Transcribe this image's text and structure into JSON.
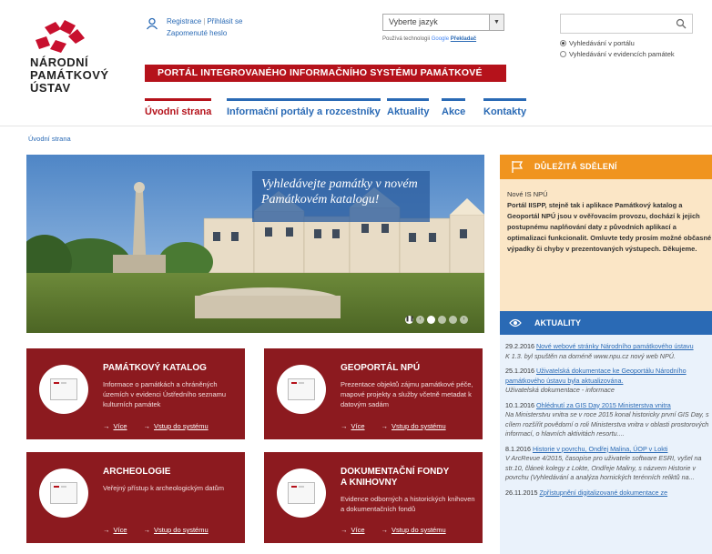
{
  "logo": {
    "text_line1": "NÁRODNÍ",
    "text_line2": "PAMÁTKOVÝ",
    "text_line3": "ÚSTAV"
  },
  "user": {
    "register": "Registrace",
    "login": "Přihlásit se",
    "forgot": "Zapomenuté heslo"
  },
  "language": {
    "selected": "Vyberte jazyk",
    "powered_prefix": "Používá technologii",
    "google": "Google",
    "translate": "Překladač"
  },
  "search": {
    "placeholder": "",
    "radio_portal": "Vyhledávání v portálu",
    "radio_evidence": "Vyhledávání v evidencích památek"
  },
  "banner": "PORTÁL INTEGROVANÉHO INFORMAČNÍHO SYSTÉMU PAMÁTKOVÉ PÉČE",
  "nav": [
    "Úvodní strana",
    "Informační portály a rozcestníky",
    "Aktuality",
    "Akce",
    "Kontakty"
  ],
  "breadcrumb": "Úvodní strana",
  "hero": {
    "caption_line1": "Vyhledávejte památky v novém",
    "caption_line2": "Památkovém katalogu!"
  },
  "cards": [
    {
      "title": "PAMÁTKOVÝ KATALOG",
      "title2": "",
      "desc": "Informace o památkách a chráněných územích v evidenci Ústředního seznamu kulturních památek",
      "more": "Více",
      "enter": "Vstup do systému"
    },
    {
      "title": "GEOPORTÁL NPÚ",
      "title2": "",
      "desc": "Prezentace objektů zájmu památkové péče, mapové projekty a služby včetně metadat k datovým sadám",
      "more": "Více",
      "enter": "Vstup do systému"
    },
    {
      "title": "ARCHEOLOGIE",
      "title2": "",
      "desc": "Veřejný přístup k archeologickým datům",
      "more": "Více",
      "enter": "Vstup do systému"
    },
    {
      "title": "DOKUMENTAČNÍ FONDY",
      "title2": "A KNIHOVNY",
      "desc": "Evidence odborných a historických knihoven a dokumentačních fondů",
      "more": "Více",
      "enter": "Vstup do systému"
    }
  ],
  "important": {
    "heading": "DŮLEŽITÁ SDĚLENÍ",
    "label": "Nové IS NPÚ",
    "body": "Portál IISPP, stejně tak i aplikace Památkový katalog a Geoportál NPÚ jsou v ověřovacím provozu, dochází k jejich postupnému naplňování daty z původních aplikací a optimalizaci funkcionalit. Omluvte tedy prosím možné občasné výpadky či chyby v prezentovaných výstupech. Děkujeme."
  },
  "news": {
    "heading": "AKTUALITY",
    "items": [
      {
        "date": "29.2.2016",
        "link": "Nové webové stránky Národního památkového ústavu",
        "text": "K 1.3. byl spuštěn na doméně www.npu.cz nový web NPÚ."
      },
      {
        "date": "25.1.2016",
        "link": "Uživatelská dokumentace ke Geoportálu Národního památkového ústavu byla aktualizována.",
        "text": "Uživatelská dokumentace - informace"
      },
      {
        "date": "10.1.2016",
        "link": "Ohlédnutí za GIS Day 2015 Ministerstva vnitra",
        "text": "Na Ministerstvu vnitra se v roce 2015 konal historicky první GIS Day, s cílem rozšířit povědomí o roli Ministerstva vnitra v oblasti prostorových informací, o hlavních aktivitách resortu...."
      },
      {
        "date": "8.1.2016",
        "link": "Historie v povrchu, Ondřej Malina, ÚOP v Lokti",
        "text": "V ArcRevue 4/2015, časopise pro uživatele software ESRI, vyšel na str.10, článek kolegy z Lokte, Ondřeje Maliny, s názvem Historie v povrchu (Vyhledávání a analýza hornických terénních reliktů na..."
      },
      {
        "date": "26.11.2015",
        "link": "Zpřístupnění digitalizované dokumentace ze",
        "text": ""
      }
    ]
  },
  "colors": {
    "brand_red": "#b5121b",
    "card_red": "#8c1a1f",
    "link_blue": "#2a6ab5",
    "orange": "#f0941f"
  }
}
